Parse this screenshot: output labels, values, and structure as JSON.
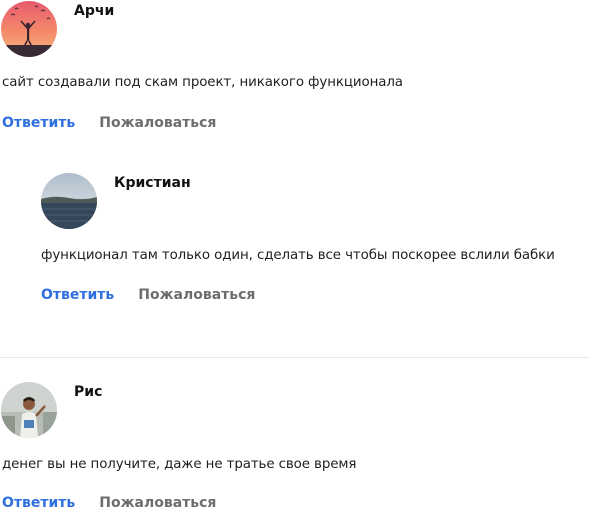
{
  "comments": [
    {
      "author": "Арчи",
      "avatar_icon": "sunset-silhouette-avatar",
      "text": "сайт создавали под скам проект, никакого функционала",
      "reply_label": "Ответить",
      "report_label": "Пожаловаться"
    },
    {
      "author": "Кристиан",
      "avatar_icon": "lake-landscape-avatar",
      "text": "функционал там только один, сделать все чтобы поскорее вслили бабки",
      "reply_label": "Ответить",
      "report_label": "Пожаловаться",
      "is_reply": true
    },
    {
      "author": "Рис",
      "avatar_icon": "person-photo-avatar",
      "text": "денег вы не получите, даже не тратье свое время",
      "reply_label": "Ответить",
      "report_label": "Пожаловаться"
    }
  ],
  "colors": {
    "link": "#2f6fe0",
    "muted": "#6d6d6d",
    "divider": "#e6e6e6"
  }
}
